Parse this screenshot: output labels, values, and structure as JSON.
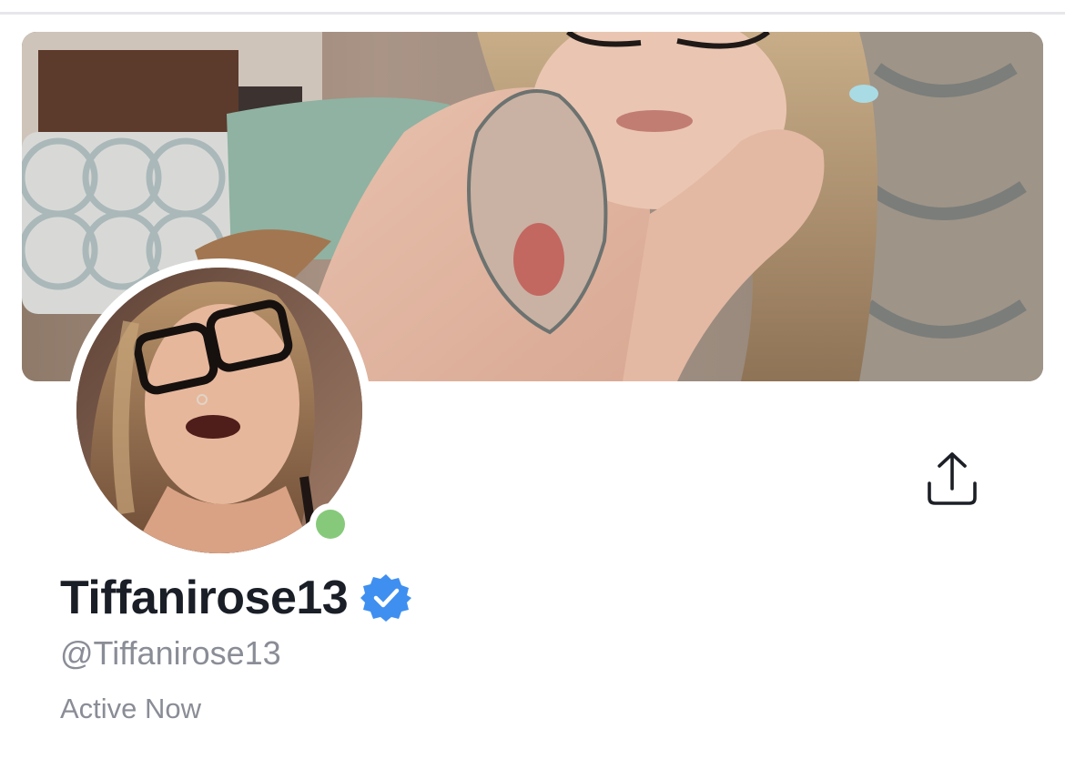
{
  "profile": {
    "display_name": "Tiffanirose13",
    "handle": "@Tiffanirose13",
    "status": "Active Now",
    "verified": true,
    "online": true
  },
  "banner": {
    "image_alt": "cover-photo"
  },
  "avatar": {
    "image_alt": "profile-photo"
  },
  "actions": {
    "share_icon": "share-icon"
  },
  "colors": {
    "online_dot": "#86c97a",
    "verified_badge": "#3f8ff0",
    "name_text": "#1a1e26",
    "secondary_text": "#8a8d96",
    "divider": "#e6e7eb"
  }
}
